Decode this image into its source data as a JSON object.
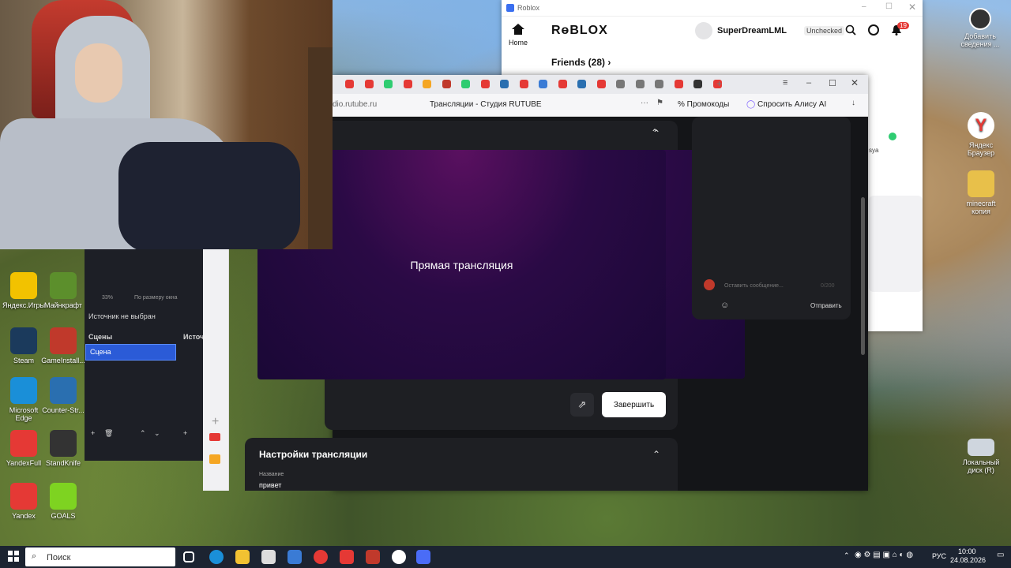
{
  "roblox": {
    "titlebar_label": "Roblox",
    "logo": "RɵBLOX",
    "home_label": "Home",
    "username": "SuperDreamLML",
    "badge": "Unchecked",
    "notif_count": "19",
    "friends": "Friends (28) ›",
    "side_label": "sya"
  },
  "browser": {
    "url": "dio.rutube.ru",
    "page_title": "Трансляции - Студия RUTUBE",
    "promo_label": "Промокоды",
    "alice_label": "Спросить Алису AI"
  },
  "stream": {
    "player_label": "Прямая трансляция",
    "end_button": "Завершить",
    "chat_placeholder": "Оставить сообщение...",
    "chat_counter": "0/200",
    "send_button": "Отправить",
    "settings_title": "Настройки трансляции",
    "name_label": "Название",
    "name_value": "привет"
  },
  "obs": {
    "zoom": "33%",
    "fit_label": "По размеру окна",
    "source_none": "Источник не выбран",
    "scenes_header": "Сцены",
    "sources_header": "Источ",
    "scene_item": "Сцена"
  },
  "desktop_icons": [
    {
      "label": "Яндекс.Игры",
      "color": "#f2c200"
    },
    {
      "label": "Майнкрафт",
      "color": "#5c8f2c"
    },
    {
      "label": "Steam",
      "color": "#1b3a5c"
    },
    {
      "label": "GameInstall...",
      "color": "#c0392b"
    },
    {
      "label": "Microsoft Edge",
      "color": "#1a8fd8"
    },
    {
      "label": "Counter-Str...",
      "color": "#2a6fb0"
    },
    {
      "label": "YandexFull",
      "color": "#e53935"
    },
    {
      "label": "StandKnife",
      "color": "#333333"
    },
    {
      "label": "Yandex",
      "color": "#e53935"
    },
    {
      "label": "GOALS",
      "color": "#7ed321"
    }
  ],
  "right_icons": {
    "top": "Добавить сведения ...",
    "yandex": "Яндекс Браузер",
    "minecraft": "minecraft копия",
    "disk": "Локальный диск (R)"
  },
  "taskbar": {
    "search": "Поиск",
    "lang": "РУС",
    "time": "10:00",
    "date": "24.08.2026"
  }
}
